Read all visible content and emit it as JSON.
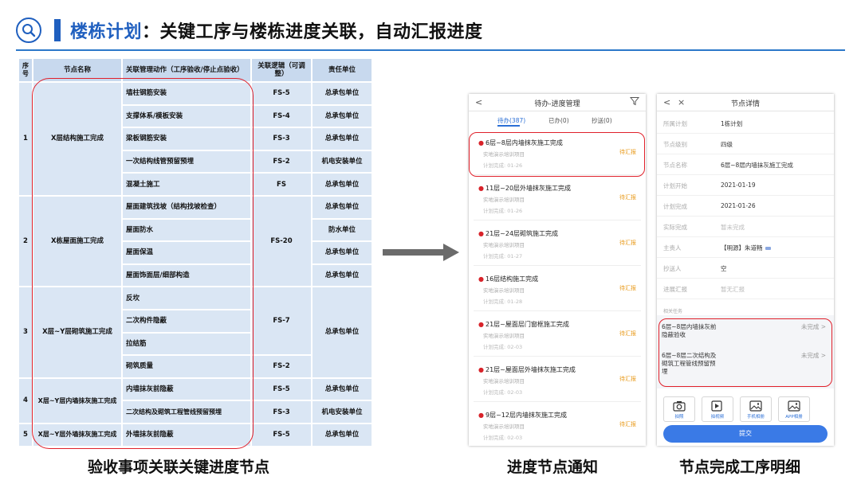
{
  "header": {
    "title_accent": "楼栋计划",
    "title_rest": "：关键工序与楼栋进度关联，自动汇报进度",
    "accent_color": "#1f5fbf",
    "icon": "search-icon"
  },
  "table": {
    "headers": [
      "序号",
      "节点名称",
      "关联管理动作（工序验收/停止点验收）",
      "关联逻辑（可调整）",
      "责任单位"
    ],
    "groups": [
      {
        "no": "1",
        "node": "X层结构施工完成",
        "rows": [
          {
            "action": "墙柱钢筋安装",
            "logic": "FS-5",
            "unit": "总承包单位"
          },
          {
            "action": "支撑体系/模板安装",
            "logic": "FS-4",
            "unit": "总承包单位"
          },
          {
            "action": "梁板钢筋安装",
            "logic": "FS-3",
            "unit": "总承包单位"
          },
          {
            "action": "一次结构线管预留预埋",
            "logic": "FS-2",
            "unit": "机电安装单位"
          },
          {
            "action": "混凝土施工",
            "logic": "FS",
            "unit": "总承包单位"
          }
        ]
      },
      {
        "no": "2",
        "node": "X栋屋面施工完成",
        "logic": "FS-20",
        "rows": [
          {
            "action": "屋面建筑找坡（结构找坡检查）",
            "unit": "总承包单位"
          },
          {
            "action": "屋面防水",
            "unit": "防水单位"
          },
          {
            "action": "屋面保温",
            "unit": "总承包单位"
          },
          {
            "action": "屋面饰面层/细部构造",
            "unit": "总承包单位"
          }
        ]
      },
      {
        "no": "3",
        "node": "X层~Y层砌筑施工完成",
        "logic_a": "FS-7",
        "logic_b": "FS-2",
        "unit": "总承包单位",
        "rows": [
          {
            "action": "反坎"
          },
          {
            "action": "二次构件隐蔽"
          },
          {
            "action": "拉结筋"
          },
          {
            "action": "砌筑质量"
          }
        ]
      },
      {
        "no": "4",
        "node": "X层~Y层内墙抹灰施工完成",
        "rows": [
          {
            "action": "内墙抹灰前隐蔽",
            "logic": "FS-5",
            "unit": "总承包单位"
          },
          {
            "action": "二次结构及砌筑工程管线预留预埋",
            "logic": "FS-3",
            "unit": "机电安装单位"
          }
        ]
      },
      {
        "no": "5",
        "node": "X层~Y层外墙抹灰施工完成",
        "rows": [
          {
            "action": "外墙抹灰前隐蔽",
            "logic": "FS-5",
            "unit": "总承包单位"
          }
        ]
      }
    ]
  },
  "captions": {
    "left": "验收事项关联关键进度节点",
    "middle": "进度节点通知",
    "right": "节点完成工序明细"
  },
  "phone1": {
    "back": "<",
    "title": "待办-进度管理",
    "filter_icon": "filter-icon",
    "tabs": [
      "待办(387)",
      "已办(0)",
      "抄送(0)"
    ],
    "tasks": [
      {
        "title": "6层~8层内墙抹灰施工完成",
        "sub": "实地演示培训项目",
        "date": "计划完成: 01-26",
        "status": "待汇报"
      },
      {
        "title": "11层~20层外墙抹灰施工完成",
        "sub": "实地演示培训项目",
        "date": "计划完成: 01-26",
        "status": "待汇报"
      },
      {
        "title": "21层~24层砌筑施工完成",
        "sub": "实地演示培训项目",
        "date": "计划完成: 01-27",
        "status": "待汇报"
      },
      {
        "title": "16层结构施工完成",
        "sub": "实地演示培训项目",
        "date": "计划完成: 01-28",
        "status": "待汇报"
      },
      {
        "title": "21层~屋面层门窗框施工完成",
        "sub": "实地演示培训项目",
        "date": "计划完成: 02-03",
        "status": "待汇报"
      },
      {
        "title": "21层~屋面层外墙抹灰施工完成",
        "sub": "实地演示培训项目",
        "date": "计划完成: 02-03",
        "status": "待汇报"
      },
      {
        "title": "9层~12层内墙抹灰施工完成",
        "sub": "实地演示培训项目",
        "date": "计划完成: 02-03",
        "status": "待汇报"
      }
    ]
  },
  "phone2": {
    "back": "<",
    "close": "×",
    "title": "节点详情",
    "details": [
      {
        "k": "所属计划",
        "v": "1栋计划"
      },
      {
        "k": "节点级别",
        "v": "四级"
      },
      {
        "k": "节点名称",
        "v": "6层~8层内墙抹灰施工完成"
      },
      {
        "k": "计划开始",
        "v": "2021-01-19"
      },
      {
        "k": "计划完成",
        "v": "2021-01-26"
      },
      {
        "k": "实际完成",
        "v": "暂未完成"
      },
      {
        "k": "主责人",
        "v": "【明源】朱道畅"
      },
      {
        "k": "抄送人",
        "v": "空"
      },
      {
        "k": "进展汇报",
        "v": "暂无汇报"
      }
    ],
    "related_label": "相关任务",
    "related": [
      {
        "text": "6层~8层内墙抹灰前隐蔽验收",
        "status": "未完成 >"
      },
      {
        "text": "6层~8层二次结构及砌筑工程管线预留预埋",
        "status": "未完成 >"
      }
    ],
    "tools": [
      "拍照",
      "拍视频",
      "手机相册",
      "APP相册"
    ],
    "submit": "提交"
  }
}
